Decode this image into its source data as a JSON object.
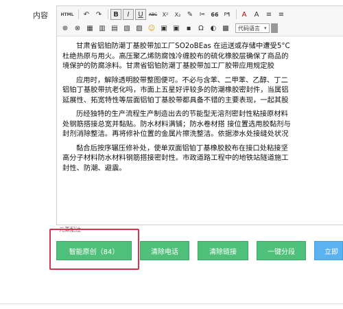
{
  "field_label": "内容",
  "toolbar": {
    "html_label": "HTML",
    "row1": [
      "↶",
      "↷",
      "B",
      "I",
      "U",
      "ABC",
      "X²",
      "X₂",
      "✎",
      "✂",
      "66",
      "P¶",
      "A",
      "A",
      "≡",
      "≡"
    ],
    "row2": [
      "⊕",
      "⊗",
      "▦",
      "▥",
      "▤",
      "▧",
      "▨",
      "☺",
      "▣",
      "▣",
      "▪",
      "Ω",
      "◐",
      "▩"
    ],
    "code_language_label": "代码语言",
    "select_arrow": "▾"
  },
  "editor": {
    "paragraphs": [
      [
        "甘肃省铝铂防潮丁基胶带加工厂SO2oBEas 在运送或存储中遭受5°C",
        "杜绝热原与用火。高压聚乙烯防腐蚀冷缠胶布的硫化橡胶层确保了商品的",
        "境保护的防腐涂料。甘肃省铝铂防潮丁基胶带加工厂胶带应用规定胶"
      ],
      [
        "应用时，解除透明胶带整图便可。不必与含苯、二甲苯、乙醇、丁二",
        "铝铂丁基胶带抗老化吗，市面上五星好评较多的防潮橡胶密封件，当属铝",
        "延展性、拓宽特性等层面铝铂丁基胶带都具备不错的主要表现，一起其股"
      ],
      [
        "历经独特的生产流程生产制造出去的节能型无溶剂密封性粘接原材料",
        "处钢筋搭接总宽并黏贴。防水材料满铺；防水卷材搭 接位置选用胶黏剂与",
        "封剂消除整洁。再将修补位置的金属片擦洗整洁。依据渗水处接缝处状况"
      ],
      [
        "黏合后按序辗压修补处，使单双面铝铂丁基橡胶胶布在接口处粘接坚",
        "高分子材料防水材料钢筋搭接密封性。市政道路工程中的地铁站隧道施工",
        "封性、防潮、避震。"
      ]
    ]
  },
  "word_count_label": "元素配注",
  "actions": {
    "smart_original": "智能原创（84）",
    "clear_phone": "清除电话",
    "clear_links": "清除链接",
    "one_click_paragraph": "一键分段",
    "publish_now": "立即"
  },
  "colors": {
    "button_green": "#4fc07a",
    "button_blue": "#5ab3f0",
    "highlight_red": "#d8334a"
  }
}
